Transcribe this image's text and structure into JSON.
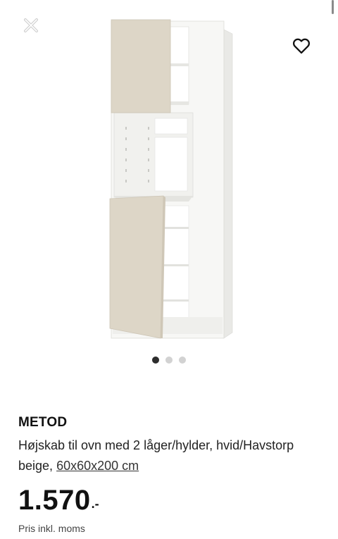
{
  "product": {
    "brand": "METOD",
    "description": "Højskab til ovn med 2 låger/hylder, hvid/Havstorp beige,",
    "size": "60x60x200 cm",
    "price": "1.570",
    "price_suffix": ".-",
    "price_note": "Pris inkl. moms"
  },
  "carousel": {
    "total": 3,
    "active": 1
  },
  "icons": {
    "close": "close-icon",
    "favourite": "heart-icon"
  },
  "colors": {
    "door": "#ddd6c7",
    "frame": "#f4f4f2",
    "dot_active": "#2d2d2d",
    "dot_inactive": "#d2d2d2"
  }
}
